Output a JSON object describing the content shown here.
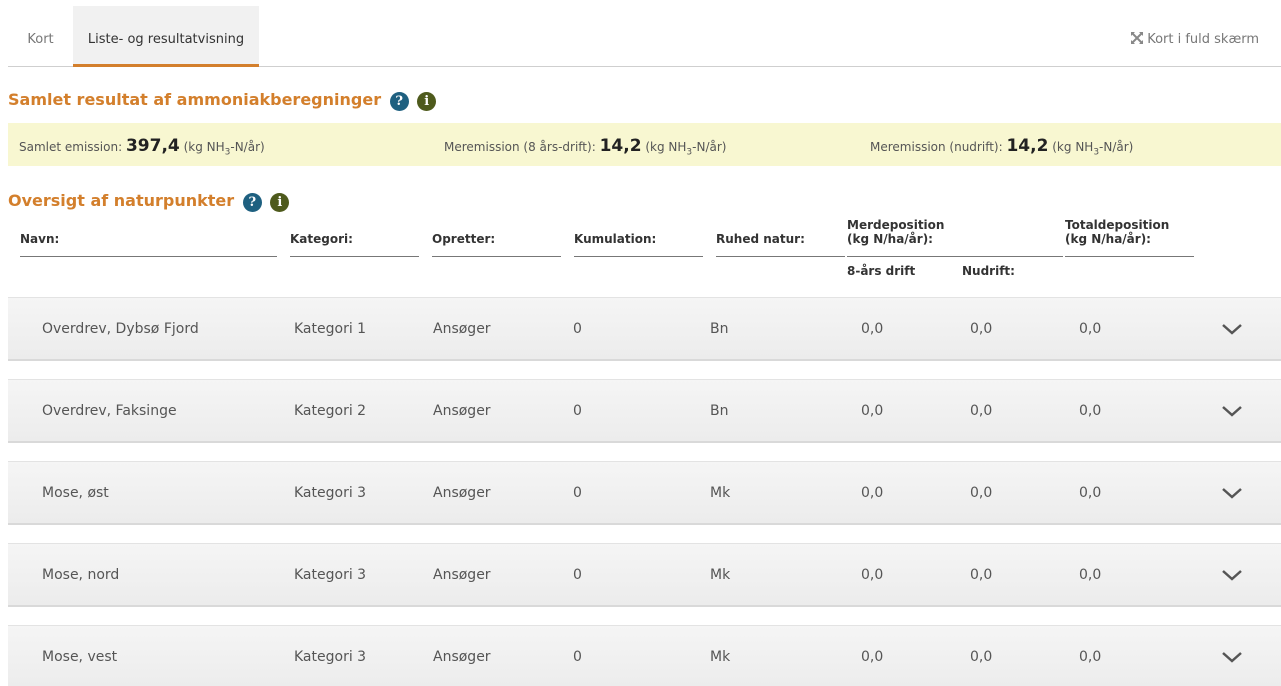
{
  "tabs": {
    "kort": "Kort",
    "liste": "Liste- og resultatvisning",
    "fullscreen": "Kort i fuld skærm"
  },
  "result": {
    "title": "Samlet resultat af ammoniakberegninger",
    "total_label": "Samlet emission:",
    "total_value": "397,4",
    "mer8_label": "Meremission (8 års-drift):",
    "mer8_value": "14,2",
    "nud_label": "Meremission (nudrift):",
    "nud_value": "14,2",
    "unit_pre": "(kg NH",
    "unit_sub": "3",
    "unit_post": "-N/år)"
  },
  "overview": {
    "title": "Oversigt af naturpunkter",
    "headers": {
      "navn": "Navn:",
      "kategori": "Kategori:",
      "opretter": "Opretter:",
      "kumulation": "Kumulation:",
      "ruhed": "Ruhed natur:",
      "merdep_1": "Merdeposition",
      "merdep_2": "(kg N/ha/år):",
      "total_1": "Totaldeposition",
      "total_2": "(kg N/ha/år):",
      "drift8": "8-års drift",
      "nudrift": "Nudrift:"
    },
    "rows": [
      {
        "navn": "Overdrev, Dybsø Fjord",
        "kategori": "Kategori 1",
        "opretter": "Ansøger",
        "kumulation": "0",
        "ruhed": "Bn",
        "drift8": "0,0",
        "nudrift": "0,0",
        "total": "0,0"
      },
      {
        "navn": "Overdrev, Faksinge",
        "kategori": "Kategori 2",
        "opretter": "Ansøger",
        "kumulation": "0",
        "ruhed": "Bn",
        "drift8": "0,0",
        "nudrift": "0,0",
        "total": "0,0"
      },
      {
        "navn": "Mose, øst",
        "kategori": "Kategori 3",
        "opretter": "Ansøger",
        "kumulation": "0",
        "ruhed": "Mk",
        "drift8": "0,0",
        "nudrift": "0,0",
        "total": "0,0"
      },
      {
        "navn": "Mose, nord",
        "kategori": "Kategori 3",
        "opretter": "Ansøger",
        "kumulation": "0",
        "ruhed": "Mk",
        "drift8": "0,0",
        "nudrift": "0,0",
        "total": "0,0"
      },
      {
        "navn": "Mose, vest",
        "kategori": "Kategori 3",
        "opretter": "Ansøger",
        "kumulation": "0",
        "ruhed": "Mk",
        "drift8": "0,0",
        "nudrift": "0,0",
        "total": "0,0"
      }
    ]
  },
  "colors": {
    "accent": "#d37f2c",
    "help_icon": "#1e6080",
    "info_icon": "#4e5a1c",
    "emission_bg": "#f8f7d1"
  },
  "icons": {
    "help": "question-circle-icon",
    "info": "info-circle-icon",
    "fullscreen": "expand-icon",
    "expand_row": "chevron-down-icon"
  }
}
